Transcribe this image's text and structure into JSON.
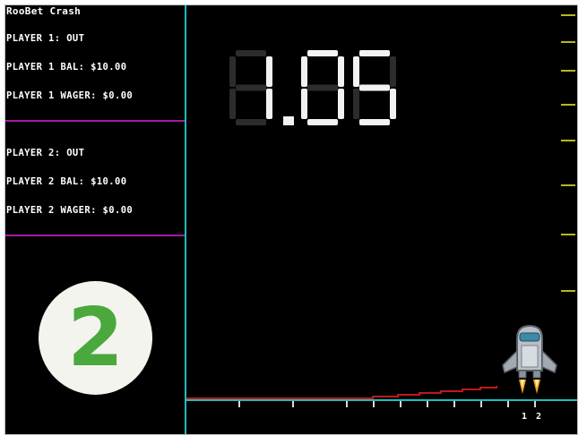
{
  "game": {
    "title": "RooBet Crash",
    "multiplier": "1.05",
    "round_number": "2"
  },
  "players": [
    {
      "status": "PLAYER 1: OUT",
      "balance": "PLAYER 1 BAL: $10.00",
      "wager": "PLAYER 1 WAGER: $0.00"
    },
    {
      "status": "PLAYER 2: OUT",
      "balance": "PLAYER 2 BAL: $10.00",
      "wager": "PLAYER 2 WAGER: $0.00"
    }
  ],
  "axis": {
    "x_labels": [
      "1",
      "2"
    ]
  },
  "colors": {
    "background": "#000000",
    "divider": "#a61aa6",
    "axis": "#1fbdbd",
    "y_ticks": "#b8b81e",
    "curve": "#c01818",
    "badge_digit": "#4aa83c"
  },
  "icons": [
    "rocket-icon"
  ]
}
